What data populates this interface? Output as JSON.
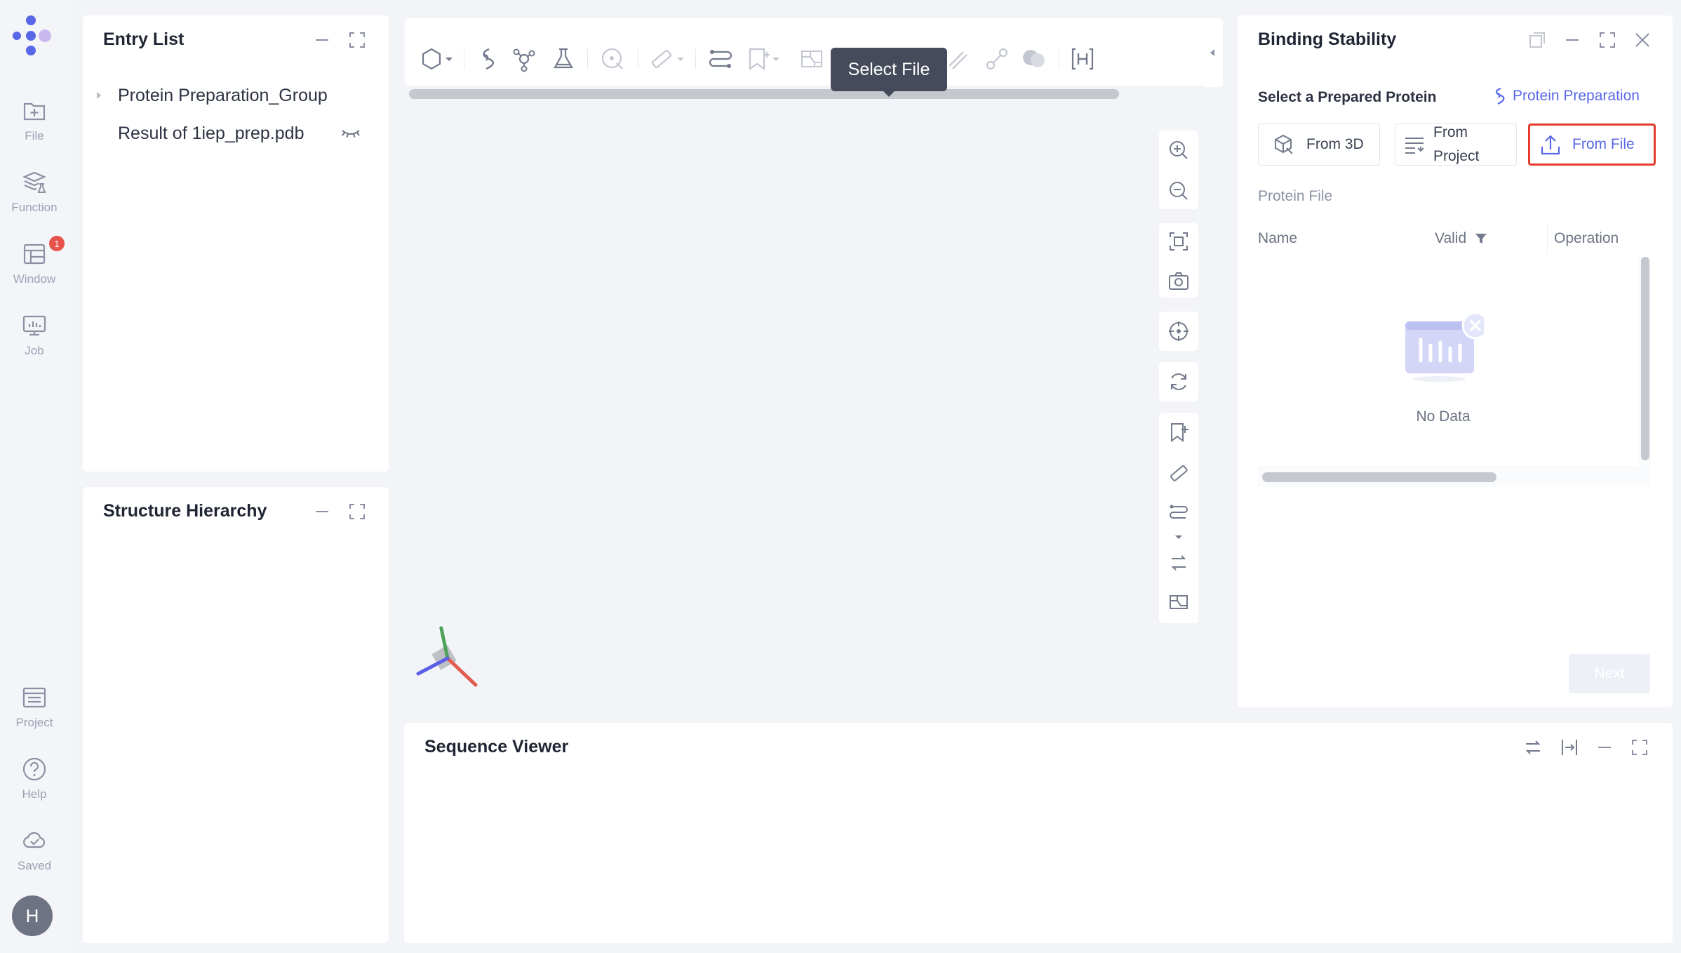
{
  "nav": {
    "items": [
      {
        "label": "File",
        "icon": "file-add-icon"
      },
      {
        "label": "Function",
        "icon": "layers-flask-icon"
      },
      {
        "label": "Window",
        "icon": "window-layout-icon",
        "badge": "1"
      },
      {
        "label": "Job",
        "icon": "monitor-icon"
      },
      {
        "label": "Project",
        "icon": "list-document-icon"
      },
      {
        "label": "Help",
        "icon": "help-circle-icon"
      },
      {
        "label": "Saved",
        "icon": "cloud-check-icon"
      }
    ],
    "avatar_initial": "H"
  },
  "entry_list": {
    "title": "Entry List",
    "items": [
      {
        "label": "Protein Preparation_Group",
        "expandable": true
      },
      {
        "label": "Result of 1iep_prep.pdb",
        "visibility_icon": "eye-closed-icon"
      }
    ]
  },
  "structure_hierarchy": {
    "title": "Structure Hierarchy"
  },
  "sequence_viewer": {
    "title": "Sequence Viewer"
  },
  "binding_stability": {
    "title": "Binding Stability",
    "subtitle": "Select a Prepared Protein",
    "link_label": "Protein Preparation",
    "sources": [
      {
        "label": "From 3D",
        "icon": "cube-select-icon"
      },
      {
        "label": "From Project",
        "icon": "list-icon"
      },
      {
        "label": "From File",
        "icon": "upload-icon",
        "active": true
      }
    ],
    "tooltip": "Select File",
    "field_label": "Protein File",
    "columns": [
      "Name",
      "Valid",
      "Operation"
    ],
    "empty_text": "No Data",
    "next_label": "Next"
  },
  "colors": {
    "accent": "#5868e8",
    "highlight_border": "#e63b2e",
    "badge": "#e5534b",
    "axis_x": "#e25b4f",
    "axis_y": "#4ea25a",
    "axis_z": "#5b5ee6"
  }
}
